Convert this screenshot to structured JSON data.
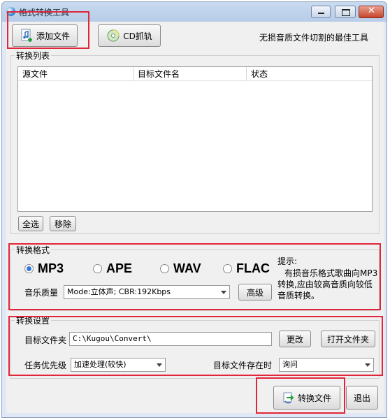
{
  "window": {
    "title": "格式转换工具"
  },
  "toolbar": {
    "add_file": "添加文件",
    "cd_rip": "CD抓轨",
    "slogan": "无损音质文件切割的最佳工具"
  },
  "list": {
    "group_label": "转换列表",
    "columns": [
      "源文件",
      "目标文件名",
      "状态"
    ],
    "select_all": "全选",
    "remove": "移除"
  },
  "format": {
    "group_label": "转换格式",
    "options": [
      "MP3",
      "APE",
      "WAV",
      "FLAC"
    ],
    "selected": "MP3",
    "quality_label": "音乐质量",
    "quality_value": "Mode:立体声; CBR:192Kbps",
    "advanced": "高级",
    "tip_title": "提示:",
    "tip_lines": [
      "有损音乐格式歌曲向MP3",
      "转换,应由较高音质向较低",
      "音质转换。"
    ]
  },
  "settings": {
    "group_label": "转换设置",
    "target_folder_label": "目标文件夹",
    "target_folder_value": "C:\\Kugou\\Convert\\",
    "change": "更改",
    "open_folder": "打开文件夹",
    "priority_label": "任务优先级",
    "priority_value": "加速处理(较快)",
    "exists_label": "目标文件存在时",
    "exists_value": "询问"
  },
  "footer": {
    "convert": "转换文件",
    "exit": "退出"
  }
}
